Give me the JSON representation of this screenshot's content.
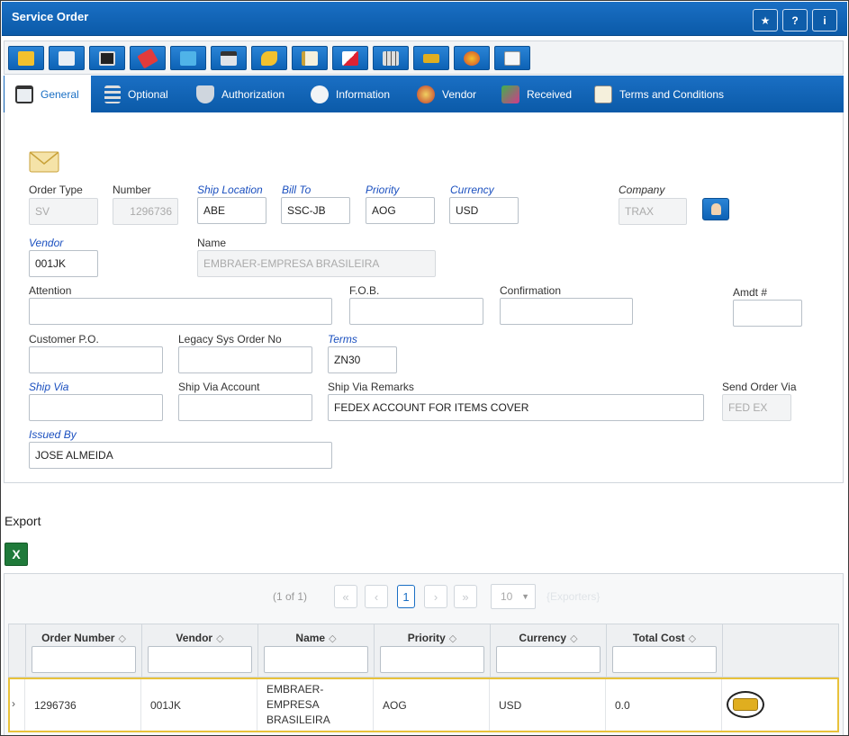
{
  "window": {
    "title": "Service Order",
    "buttons": [
      "★",
      "?",
      "i"
    ]
  },
  "toolbar": {
    "tools": [
      "refresh-icon",
      "new-record-icon",
      "save-icon",
      "erase-icon",
      "book-icon",
      "print-icon",
      "undo-icon",
      "notes-icon",
      "chart-icon",
      "grid-icon",
      "link-icon",
      "globe-icon",
      "document-icon"
    ]
  },
  "tabs": [
    {
      "label": "General",
      "icon": "window-icon"
    },
    {
      "label": "Optional",
      "icon": "sliders-icon"
    },
    {
      "label": "Authorization",
      "icon": "shield-icon"
    },
    {
      "label": "Information",
      "icon": "info-icon"
    },
    {
      "label": "Vendor",
      "icon": "vendor-icon"
    },
    {
      "label": "Received",
      "icon": "received-icon"
    },
    {
      "label": "Terms and Conditions",
      "icon": "clipboard-icon"
    }
  ],
  "form": {
    "order_type": {
      "label": "Order Type",
      "value": "SV"
    },
    "number": {
      "label": "Number",
      "value": "1296736"
    },
    "ship_location": {
      "label": "Ship Location",
      "value": "ABE"
    },
    "bill_to": {
      "label": "Bill To",
      "value": "SSC-JB"
    },
    "priority": {
      "label": "Priority",
      "value": "AOG"
    },
    "currency": {
      "label": "Currency",
      "value": "USD"
    },
    "company": {
      "label": "Company",
      "value": "TRAX"
    },
    "vendor": {
      "label": "Vendor",
      "value": "001JK"
    },
    "name": {
      "label": "Name",
      "value": "EMBRAER-EMPRESA BRASILEIRA"
    },
    "attention": {
      "label": "Attention",
      "value": ""
    },
    "fob": {
      "label": "F.O.B.",
      "value": ""
    },
    "confirmation": {
      "label": "Confirmation",
      "value": ""
    },
    "amdt": {
      "label": "Amdt #",
      "value": ""
    },
    "customer_po": {
      "label": "Customer P.O.",
      "value": ""
    },
    "legacy_sys_order_no": {
      "label": "Legacy Sys Order No",
      "value": ""
    },
    "terms": {
      "label": "Terms",
      "value": "ZN30"
    },
    "ship_via": {
      "label": "Ship Via",
      "value": ""
    },
    "ship_via_account": {
      "label": "Ship Via Account",
      "value": ""
    },
    "ship_via_remarks": {
      "label": "Ship Via Remarks",
      "value": "FEDEX ACCOUNT FOR ITEMS COVER"
    },
    "send_order_via": {
      "label": "Send Order Via",
      "value": "FED EX"
    },
    "issued_by": {
      "label": "Issued By",
      "value": "JOSE ALMEIDA"
    }
  },
  "export": {
    "title": "Export",
    "excel_icon": "X"
  },
  "pager": {
    "info": "(1 of 1)",
    "first": "«",
    "prev": "‹",
    "page": "1",
    "next": "›",
    "last": "»",
    "rows_per_page": "10",
    "exporters": "{Exporters}"
  },
  "table": {
    "columns": [
      "Order Number",
      "Vendor",
      "Name",
      "Priority",
      "Currency",
      "Total Cost"
    ],
    "sort_glyph": "◇",
    "rows": [
      {
        "order_number": "1296736",
        "vendor": "001JK",
        "name": "EMBRAER-EMPRESA BRASILEIRA",
        "priority": "AOG",
        "currency": "USD",
        "total_cost": "0.0"
      }
    ]
  }
}
